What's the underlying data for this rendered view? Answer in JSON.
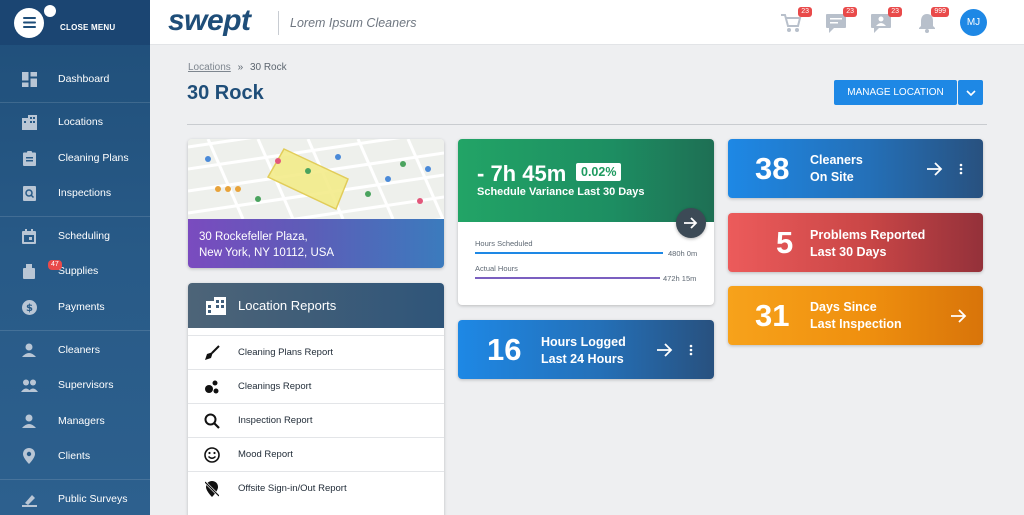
{
  "sidebar": {
    "close_label": "CLOSE MENU",
    "items": [
      {
        "label": "Dashboard",
        "icon": "dashboard-icon"
      },
      {
        "label": "Locations",
        "icon": "building-icon"
      },
      {
        "label": "Cleaning Plans",
        "icon": "clipboard-icon"
      },
      {
        "label": "Inspections",
        "icon": "inspection-icon"
      },
      {
        "label": "Scheduling",
        "icon": "calendar-icon"
      },
      {
        "label": "Supplies",
        "icon": "supplies-icon",
        "badge": "47"
      },
      {
        "label": "Payments",
        "icon": "dollar-icon"
      },
      {
        "label": "Cleaners",
        "icon": "person-icon"
      },
      {
        "label": "Supervisors",
        "icon": "people-icon"
      },
      {
        "label": "Managers",
        "icon": "manager-icon"
      },
      {
        "label": "Clients",
        "icon": "location-pin-icon"
      },
      {
        "label": "Public Surveys",
        "icon": "survey-icon"
      }
    ]
  },
  "header": {
    "logo": "swept",
    "company": "Lorem Ipsum Cleaners",
    "badges": {
      "cart": "23",
      "chat": "23",
      "messages": "23",
      "notifications": "999"
    },
    "avatar_initials": "MJ"
  },
  "breadcrumb": {
    "parent": "Locations",
    "separator": "»",
    "current": "30 Rock"
  },
  "page_title": "30 Rock",
  "manage_button": "MANAGE LOCATION",
  "address": {
    "line1": "30 Rockefeller Plaza,",
    "line2": "New York, NY 10112, USA"
  },
  "reports": {
    "title": "Location Reports",
    "items": [
      {
        "label": "Cleaning Plans Report",
        "icon": "broom-icon"
      },
      {
        "label": "Cleanings Report",
        "icon": "bubbles-icon"
      },
      {
        "label": "Inspection Report",
        "icon": "magnifier-icon"
      },
      {
        "label": "Mood Report",
        "icon": "smiley-icon"
      },
      {
        "label": "Offsite Sign-in/Out Report",
        "icon": "location-off-icon"
      }
    ]
  },
  "variance": {
    "value": "- 7h 45m",
    "pct": "0.02%",
    "label": "Schedule Variance Last 30 Days",
    "scheduled_label": "Hours Scheduled",
    "scheduled_value": "480h 0m",
    "actual_label": "Actual Hours",
    "actual_value": "472h 15m",
    "actual_fraction": 0.984
  },
  "hours_logged": {
    "number": "16",
    "line1": "Hours Logged",
    "line2": "Last 24 Hours"
  },
  "cleaners": {
    "number": "38",
    "line1": "Cleaners",
    "line2": "On Site"
  },
  "problems": {
    "number": "5",
    "line1": "Problems Reported",
    "line2": "Last 30 Days"
  },
  "days_since": {
    "number": "31",
    "line1": "Days Since",
    "line2": "Last Inspection"
  },
  "colors": {
    "brand": "#1f4e79",
    "accent": "#1e88e5",
    "green": "#21a366",
    "red": "#e94a4a",
    "orange": "#f39c12"
  }
}
